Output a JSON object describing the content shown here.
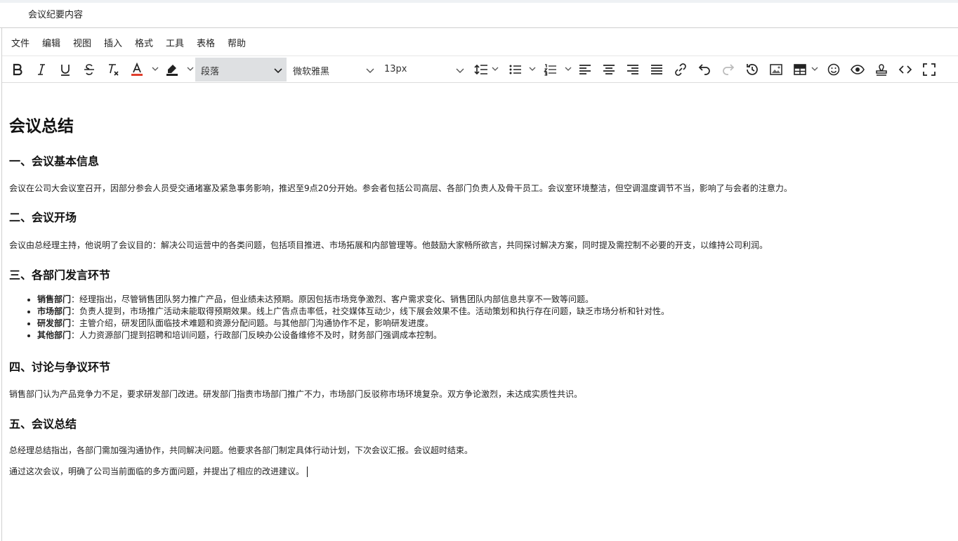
{
  "window": {
    "title": "会议纪要内容"
  },
  "menu": [
    "文件",
    "编辑",
    "视图",
    "插入",
    "格式",
    "工具",
    "表格",
    "帮助"
  ],
  "toolbar": {
    "block_format": "段落",
    "font_family": "微软雅黑",
    "font_size": "13px",
    "text_color": "#e03e2d",
    "highlight_color": "#222222",
    "tools": [
      "bold-icon",
      "italic-icon",
      "underline-icon",
      "strikethrough-icon",
      "clear-format-icon",
      "text-color-icon",
      "highlight-icon",
      "line-height-icon",
      "bullet-list-icon",
      "numbered-list-icon",
      "align-left-icon",
      "align-center-icon",
      "align-right-icon",
      "justify-icon",
      "link-icon",
      "undo-icon",
      "redo-icon",
      "history-icon",
      "image-icon",
      "table-icon",
      "emoji-icon",
      "preview-icon",
      "stamp-icon",
      "code-icon",
      "fullscreen-icon"
    ]
  },
  "document": {
    "title": "会议总结",
    "s1": {
      "heading": "一、会议基本信息",
      "text": "会议在公司大会议室召开，因部分参会人员受交通堵塞及紧急事务影响，推迟至9点20分开始。参会者包括公司高层、各部门负责人及骨干员工。会议室环境整洁，但空调温度调节不当，影响了与会者的注意力。"
    },
    "s2": {
      "heading": "二、会议开场",
      "text": "会议由总经理主持，他说明了会议目的：解决公司运营中的各类问题，包括项目推进、市场拓展和内部管理等。他鼓励大家畅所欲言，共同探讨解决方案，同时提及需控制不必要的开支，以维持公司利润。"
    },
    "s3": {
      "heading": "三、各部门发言环节",
      "items": [
        {
          "label": "销售部门",
          "text": "：经理指出，尽管销售团队努力推广产品，但业绩未达预期。原因包括市场竞争激烈、客户需求变化、销售团队内部信息共享不一致等问题。"
        },
        {
          "label": "市场部门",
          "text": "：负责人提到，市场推广活动未能取得预期效果。线上广告点击率低，社交媒体互动少，线下展会效果不佳。活动策划和执行存在问题，缺乏市场分析和针对性。"
        },
        {
          "label": "研发部门",
          "text": "：主管介绍，研发团队面临技术难题和资源分配问题。与其他部门沟通协作不足，影响研发进度。"
        },
        {
          "label": "其他部门",
          "text": "：人力资源部门提到招聘和培训问题，行政部门反映办公设备维修不及时，财务部门强调成本控制。"
        }
      ]
    },
    "s4": {
      "heading": "四、讨论与争议环节",
      "text": "销售部门认为产品竞争力不足，要求研发部门改进。研发部门指责市场部门推广不力，市场部门反驳称市场环境复杂。双方争论激烈，未达成实质性共识。"
    },
    "s5": {
      "heading": "五、会议总结",
      "text1": "总经理总结指出，各部门需加强沟通协作，共同解决问题。他要求各部门制定具体行动计划，下次会议汇报。会议超时结束。",
      "text2": "通过这次会议，明确了公司当前面临的多方面问题，并提出了相应的改进建议。"
    }
  }
}
